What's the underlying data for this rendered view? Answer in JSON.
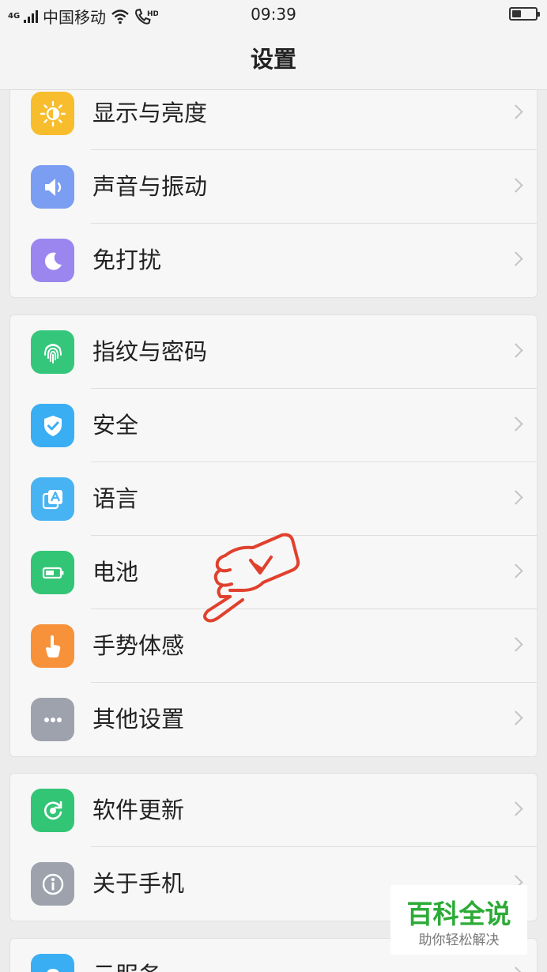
{
  "status_bar": {
    "network": "4G",
    "carrier": "中国移动",
    "hd_label": "HD",
    "time": "09:39",
    "battery_level": 0.35
  },
  "header": {
    "title": "设置"
  },
  "groups": [
    {
      "items": [
        {
          "label": "显示与亮度",
          "icon": "sun-icon",
          "color": "#f7bd2d"
        },
        {
          "label": "声音与振动",
          "icon": "speaker-icon",
          "color": "#7b9df2"
        },
        {
          "label": "免打扰",
          "icon": "moon-icon",
          "color": "#9a86ee"
        }
      ]
    },
    {
      "items": [
        {
          "label": "指纹与密码",
          "icon": "fingerprint-icon",
          "color": "#34c77b"
        },
        {
          "label": "安全",
          "icon": "shield-icon",
          "color": "#3aaef3"
        },
        {
          "label": "语言",
          "icon": "language-icon",
          "color": "#48b3f2"
        },
        {
          "label": "电池",
          "icon": "battery-icon",
          "color": "#33c576"
        },
        {
          "label": "手势体感",
          "icon": "gesture-hand-icon",
          "color": "#f7913a"
        },
        {
          "label": "其他设置",
          "icon": "more-dots-icon",
          "color": "#9da2ad"
        }
      ]
    },
    {
      "items": [
        {
          "label": "软件更新",
          "icon": "update-icon",
          "color": "#33c576"
        },
        {
          "label": "关于手机",
          "icon": "info-icon",
          "color": "#9da2ad"
        }
      ]
    },
    {
      "items": [
        {
          "label": "云服务",
          "icon": "cloud-icon",
          "color": "#3aaef3"
        }
      ]
    }
  ],
  "watermark": {
    "title": "百科全说",
    "subtitle": "助你轻松解决"
  }
}
